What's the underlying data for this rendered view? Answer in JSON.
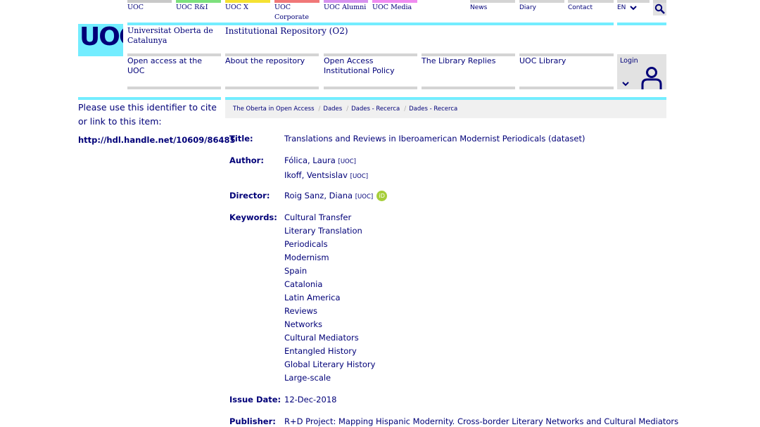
{
  "topbar": {
    "items": [
      {
        "label": "UOC",
        "color": "#c8c8c8"
      },
      {
        "label": "UOC R&I",
        "color": "#7de07d"
      },
      {
        "label": "UOC X",
        "color": "#f5e232"
      },
      {
        "label": "UOC Corporate",
        "color": "#f07878"
      },
      {
        "label": "UOC Alumni",
        "color": "#d792ee"
      },
      {
        "label": "UOC Media",
        "color": "#f08cf0"
      }
    ],
    "right_items": [
      {
        "label": "News"
      },
      {
        "label": "Diary"
      },
      {
        "label": "Contact"
      }
    ],
    "language": "EN"
  },
  "header": {
    "logo_text": "UOC",
    "university_name": "Universitat Oberta de Catalunya",
    "site_title": "Institutional Repository (O2)"
  },
  "nav": {
    "items": [
      "Open access at the UOC",
      "About the repository",
      "Open Access Institutional Policy",
      "The Library Replies",
      "UOC Library"
    ],
    "login": "Login"
  },
  "sidebar": {
    "cite_text": "Please use this identifier to cite or link to this item:",
    "handle_url": "http://hdl.handle.net/10609/86485"
  },
  "breadcrumb": [
    "The Oberta in Open Access",
    "Dades",
    "Dades - Recerca",
    "Dades - Recerca"
  ],
  "record": {
    "title_label": "Title:",
    "title": "Translations and Reviews in Iberoamerican Modernist Periodicals (dataset)",
    "author_label": "Author:",
    "authors": [
      {
        "name": "Fólica, Laura",
        "tag": "[UOC]"
      },
      {
        "name": "Ikoff, Ventsislav",
        "tag": "[UOC]"
      }
    ],
    "director_label": "Director:",
    "director": {
      "name": "Roig Sanz, Diana",
      "tag": "[UOC]",
      "orcid": "iD"
    },
    "keywords_label": "Keywords:",
    "keywords": [
      "Cultural Transfer",
      "Literary Translation",
      "Periodicals",
      "Modernism",
      "Spain",
      "Catalonia",
      "Latin America",
      "Reviews",
      "Networks",
      "Cultural Mediators",
      "Entangled History",
      "Global Literary History",
      "Large-scale"
    ],
    "issue_label": "Issue Date:",
    "issue_date": "12-Dec-2018",
    "publisher_label": "Publisher:",
    "publisher": "R+D Project: Mapping Hispanic Modernity. Cross-border Literary Networks and Cultural Mediators"
  }
}
